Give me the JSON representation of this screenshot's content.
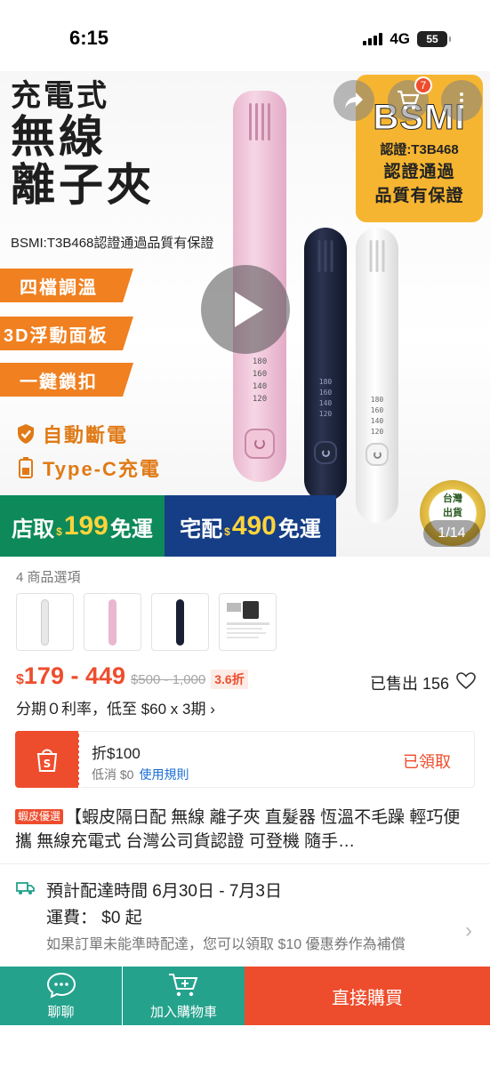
{
  "status_bar": {
    "time": "6:15",
    "network": "4G",
    "battery": "55"
  },
  "hero": {
    "title_line1": "充電式",
    "title_line2": "無線",
    "title_line3": "離子夾",
    "subtitle": "BSMI:T3B468認證通過品質有保證",
    "features": [
      "四檔調溫",
      "3D浮動面板",
      "一鍵鎖扣"
    ],
    "feature_lines": [
      "自動斷電",
      "Type-C充電"
    ],
    "temps": [
      "180",
      "160",
      "140",
      "120"
    ],
    "bsmi": {
      "logo": "BSMI",
      "cert": "認證:T3B468",
      "line3": "認證通過",
      "line4": "品質有保證"
    },
    "cart_count": "7",
    "shipping_banner": {
      "left_label": "店取",
      "left_currency": "$",
      "left_amount": "199",
      "left_suffix": "免運",
      "right_label": "宅配",
      "right_currency": "$",
      "right_amount": "490",
      "right_suffix": "免運"
    },
    "award_text": [
      "台灣",
      "出貨"
    ],
    "image_counter": "1/14"
  },
  "options": {
    "label": "4 商品選項",
    "items": [
      {
        "icon": "white-device-icon",
        "color": "#f0f0f0"
      },
      {
        "icon": "pink-device-icon",
        "color": "#e9b7cf"
      },
      {
        "icon": "black-device-icon",
        "color": "#1a2034"
      },
      {
        "icon": "charger-icon",
        "color": "#333333"
      }
    ]
  },
  "price": {
    "currency": "$",
    "range": "179 - 449",
    "original": "$500 - 1,000",
    "discount": "3.6折",
    "sold": "已售出 156",
    "installment": "分期０利率，低至 $60 x 3期 ›"
  },
  "voucher": {
    "title": "折$100",
    "min_spend": "低消 $0",
    "rules": "使用規則",
    "status": "已領取"
  },
  "product": {
    "badge": "蝦皮優選",
    "title": "【蝦皮隔日配 無線 離子夾 直髮器 恆溫不毛躁 輕巧便攜 無線充電式 台灣公司貨認證 可登機 隨手…"
  },
  "shipping": {
    "eta": "預計配達時間 6月30日 - 7月3日",
    "fee": "運費： $0 起",
    "note": "如果訂單未能準時配達，您可以領取 $10 優惠券作為補償"
  },
  "bottom_bar": {
    "chat": "聊聊",
    "add_to_cart": "加入購物車",
    "buy_now": "直接購買"
  },
  "colors": {
    "accent": "#ee4d2d",
    "teal": "#25a28c",
    "orange": "#f08020"
  }
}
